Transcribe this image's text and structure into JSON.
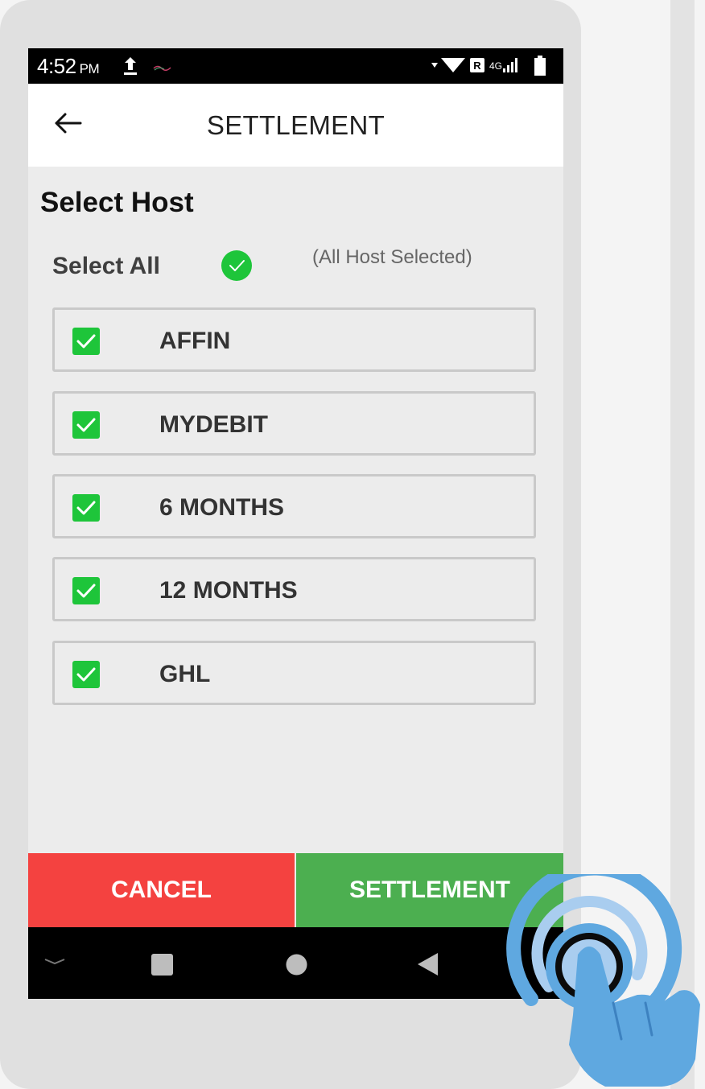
{
  "status_bar": {
    "time": "4:52",
    "ampm": "PM",
    "network": "4G"
  },
  "app_bar": {
    "title": "SETTLEMENT",
    "back_icon": "arrow-back-icon"
  },
  "content": {
    "heading": "Select Host",
    "select_all_label": "Select All",
    "select_all_checked": true,
    "all_selected_note": "(All Host Selected)",
    "hosts": [
      {
        "label": "AFFIN",
        "checked": true
      },
      {
        "label": "MYDEBIT",
        "checked": true
      },
      {
        "label": "6 MONTHS",
        "checked": true
      },
      {
        "label": "12 MONTHS",
        "checked": true
      },
      {
        "label": "GHL",
        "checked": true
      }
    ]
  },
  "actions": {
    "cancel_label": "CANCEL",
    "settle_label": "SETTLEMENT"
  },
  "nav_bar": {
    "icons": [
      "chevron-down-icon",
      "recents-square-icon",
      "home-circle-icon",
      "back-triangle-icon"
    ]
  },
  "colors": {
    "accent_green": "#4caf50",
    "check_green": "#1ec53a",
    "cancel_red": "#f44240",
    "tap_blue": "#5fa8e0"
  }
}
